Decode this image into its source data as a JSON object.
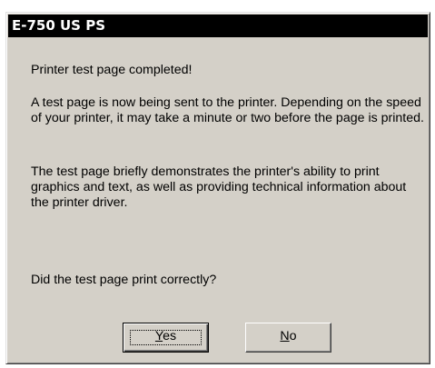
{
  "dialog": {
    "title": "E-750 US PS",
    "message_heading": "Printer test page completed!",
    "message_body_1": "A test page is now being sent to the printer. Depending on the speed of your printer, it may take a minute or two before the page is printed.",
    "message_body_2": "The test page briefly demonstrates the printer's ability to print graphics and text, as well as providing technical information about the printer driver.",
    "question": "Did the test page print correctly?",
    "buttons": {
      "yes": {
        "mnemonic": "Y",
        "rest": "es"
      },
      "no": {
        "mnemonic": "N",
        "rest": "o"
      }
    }
  }
}
